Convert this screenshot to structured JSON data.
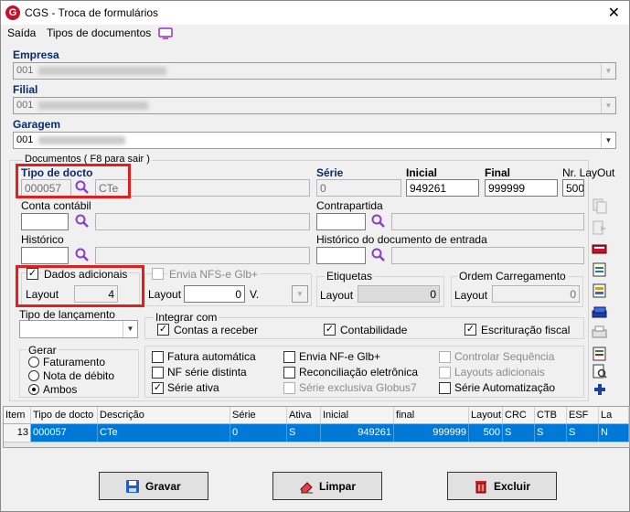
{
  "window": {
    "title": "CGS - Troca de formulários",
    "logo_letter": "G"
  },
  "menu": {
    "items": [
      "Saída",
      "Tipos de documentos"
    ]
  },
  "empresa": {
    "label": "Empresa",
    "value": "001"
  },
  "filial": {
    "label": "Filial",
    "value": "001"
  },
  "garagem": {
    "label": "Garagem",
    "value": "001"
  },
  "documentos": {
    "group_title": "Documentos ( F8 para sair )",
    "tipo_label": "Tipo de docto",
    "tipo_code": "000057",
    "tipo_desc": "CTe",
    "serie_label": "Série",
    "serie_value": "0",
    "inicial_label": "Inicial",
    "inicial_value": "949261",
    "final_label": "Final",
    "final_value": "999999",
    "nrlayout_label": "Nr. LayOut",
    "nrlayout_value": "500",
    "conta_label": "Conta contábil",
    "contrapartida_label": "Contrapartida",
    "historico_label": "Histórico",
    "historico_doc_label": "Histórico do documento de entrada"
  },
  "dados_adicionais": {
    "label": "Dados adicionais",
    "layout_label": "Layout",
    "layout_value": "4"
  },
  "nfse": {
    "label": "Envia NFS-e Glb+",
    "layout_label": "Layout",
    "layout_value": "0",
    "v_label": "V."
  },
  "etiquetas": {
    "label": "Etiquetas",
    "layout_label": "Layout",
    "layout_value": "0"
  },
  "ordem": {
    "label": "Ordem Carregamento",
    "layout_label": "Layout",
    "layout_value": "0"
  },
  "tipo_lancamento": {
    "label": "Tipo de lançamento"
  },
  "integrar": {
    "label": "Integrar com",
    "contas": "Contas a receber",
    "contabilidade": "Contabilidade",
    "escrituracao": "Escrituração fiscal"
  },
  "gerar": {
    "label": "Gerar",
    "options": [
      "Faturamento",
      "Nota de débito",
      "Ambos"
    ]
  },
  "options": {
    "fatura": "Fatura automática",
    "nf_serie": "NF série distinta",
    "serie_ativa": "Série ativa",
    "envia_nfe": "Envia NF-e Glb+",
    "reconciliacao": "Reconciliação eletrônica",
    "serie_exclusiva": "Série exclusiva Globus7",
    "controlar": "Controlar Sequência",
    "layouts": "Layouts adicionais",
    "serie_auto": "Série Automatização"
  },
  "table": {
    "headers": [
      "Item",
      "Tipo de docto",
      "Descrição",
      "Série",
      "Ativa",
      "Inicial",
      "final",
      "Layout",
      "CRC",
      "CTB",
      "ESF",
      "La"
    ],
    "row": [
      "13",
      "000057",
      "CTe",
      "0",
      "S",
      "949261",
      "999999",
      "500",
      "S",
      "S",
      "S",
      "N"
    ]
  },
  "buttons": {
    "gravar": "Gravar",
    "limpar": "Limpar",
    "excluir": "Excluir"
  },
  "colors": {
    "accent": "#0078d7",
    "highlight": "#e02020",
    "title_navy": "#0a2a6b",
    "magnifier": "#8a3fc8"
  }
}
